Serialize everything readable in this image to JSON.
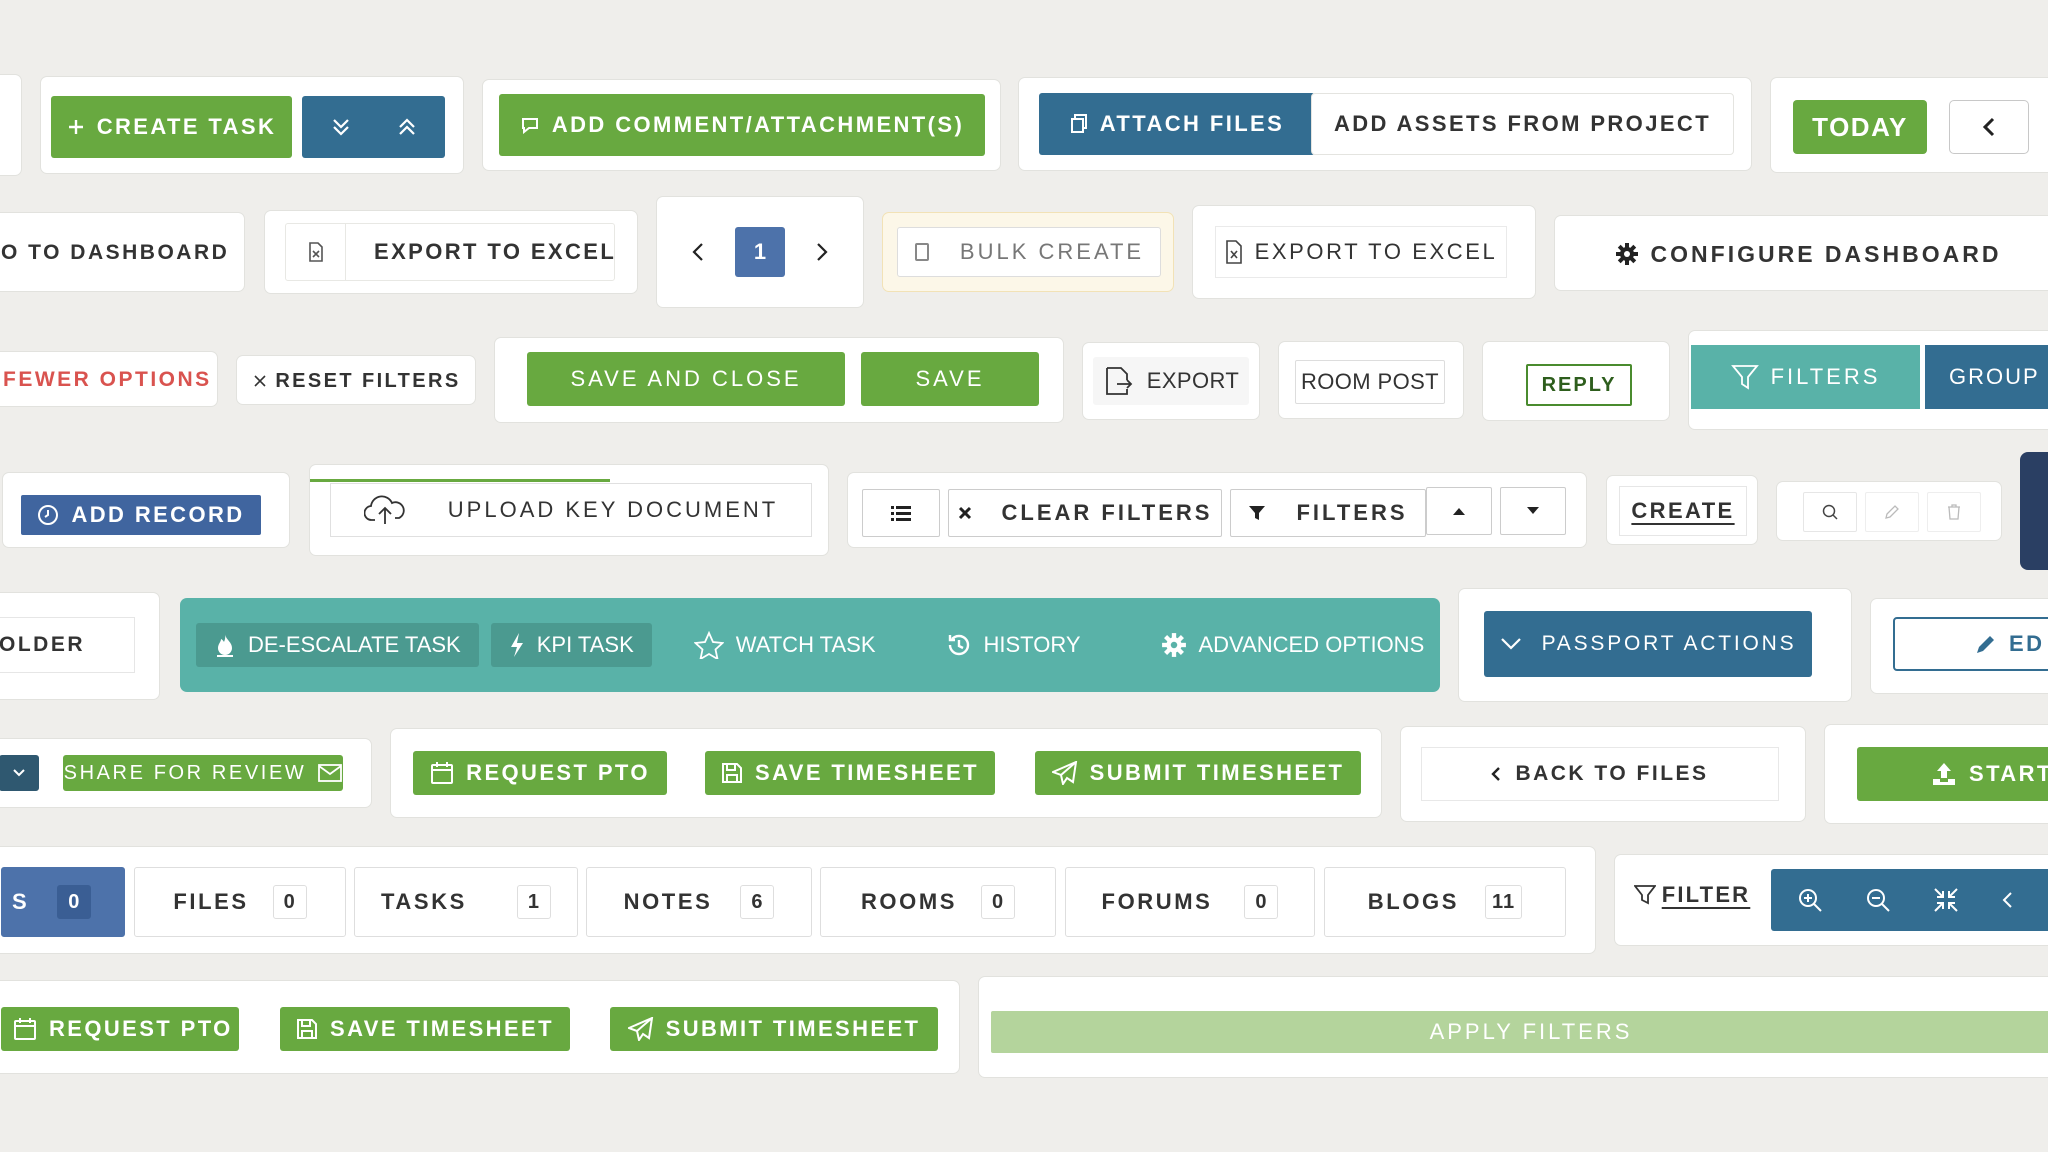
{
  "row1": {
    "create_task": "CREATE TASK",
    "add_comment": "ADD COMMENT/ATTACHMENT(S)",
    "attach_files": "ATTACH FILES",
    "add_assets": "ADD ASSETS FROM PROJECT",
    "today": "TODAY"
  },
  "row2": {
    "back_dashboard": "O TO DASHBOARD",
    "export_excel_1": "EXPORT TO EXCEL",
    "page_number": "1",
    "bulk_create": "BULK CREATE",
    "export_excel_2": "EXPORT TO EXCEL",
    "configure_dashboard": "CONFIGURE DASHBOARD"
  },
  "row3": {
    "fewer_options": "FEWER OPTIONS",
    "reset_filters": "RESET FILTERS",
    "save_and_close": "SAVE AND CLOSE",
    "save": "SAVE",
    "export": "EXPORT",
    "room_post": "ROOM POST",
    "reply": "REPLY",
    "filters": "FILTERS",
    "group": "GROUP"
  },
  "row4": {
    "add_record": "ADD RECORD",
    "upload_key_document": "UPLOAD KEY DOCUMENT",
    "upload_progress": 0.58,
    "clear_filters": "CLEAR FILTERS",
    "filters": "FILTERS",
    "create": "CREATE"
  },
  "row5": {
    "folder": "OLDER",
    "deescalate_task": "DE-ESCALATE TASK",
    "kpi_task": "KPI TASK",
    "watch_task": "WATCH TASK",
    "history": "HISTORY",
    "advanced_options": "ADVANCED OPTIONS",
    "passport_actions": "PASSPORT ACTIONS",
    "edit": "ED"
  },
  "row6": {
    "share_for_review": "SHARE FOR REVIEW",
    "request_pto": "REQUEST PTO",
    "save_timesheet": "SAVE TIMESHEET",
    "submit_timesheet": "SUBMIT TIMESHEET",
    "back_to_files": "BACK TO FILES",
    "start": "START"
  },
  "tabs": [
    {
      "label": "S",
      "count": "0"
    },
    {
      "label": "FILES",
      "count": "0"
    },
    {
      "label": "TASKS",
      "count": "1"
    },
    {
      "label": "NOTES",
      "count": "6"
    },
    {
      "label": "ROOMS",
      "count": "0"
    },
    {
      "label": "FORUMS",
      "count": "0"
    },
    {
      "label": "BLOGS",
      "count": "11"
    }
  ],
  "filter_link": "FILTER",
  "row8": {
    "request_pto": "REQUEST PTO",
    "save_timesheet": "SAVE TIMESHEET",
    "submit_timesheet": "SUBMIT TIMESHEET",
    "apply_filters": "APPLY FILTERS"
  },
  "colors": {
    "green": "#68a940",
    "blue": "#336d91",
    "teal": "#59b2a8",
    "indigo": "#4d72aa",
    "red": "#d9534f",
    "light_green": "#b4d49c",
    "background": "#efeeeb"
  }
}
